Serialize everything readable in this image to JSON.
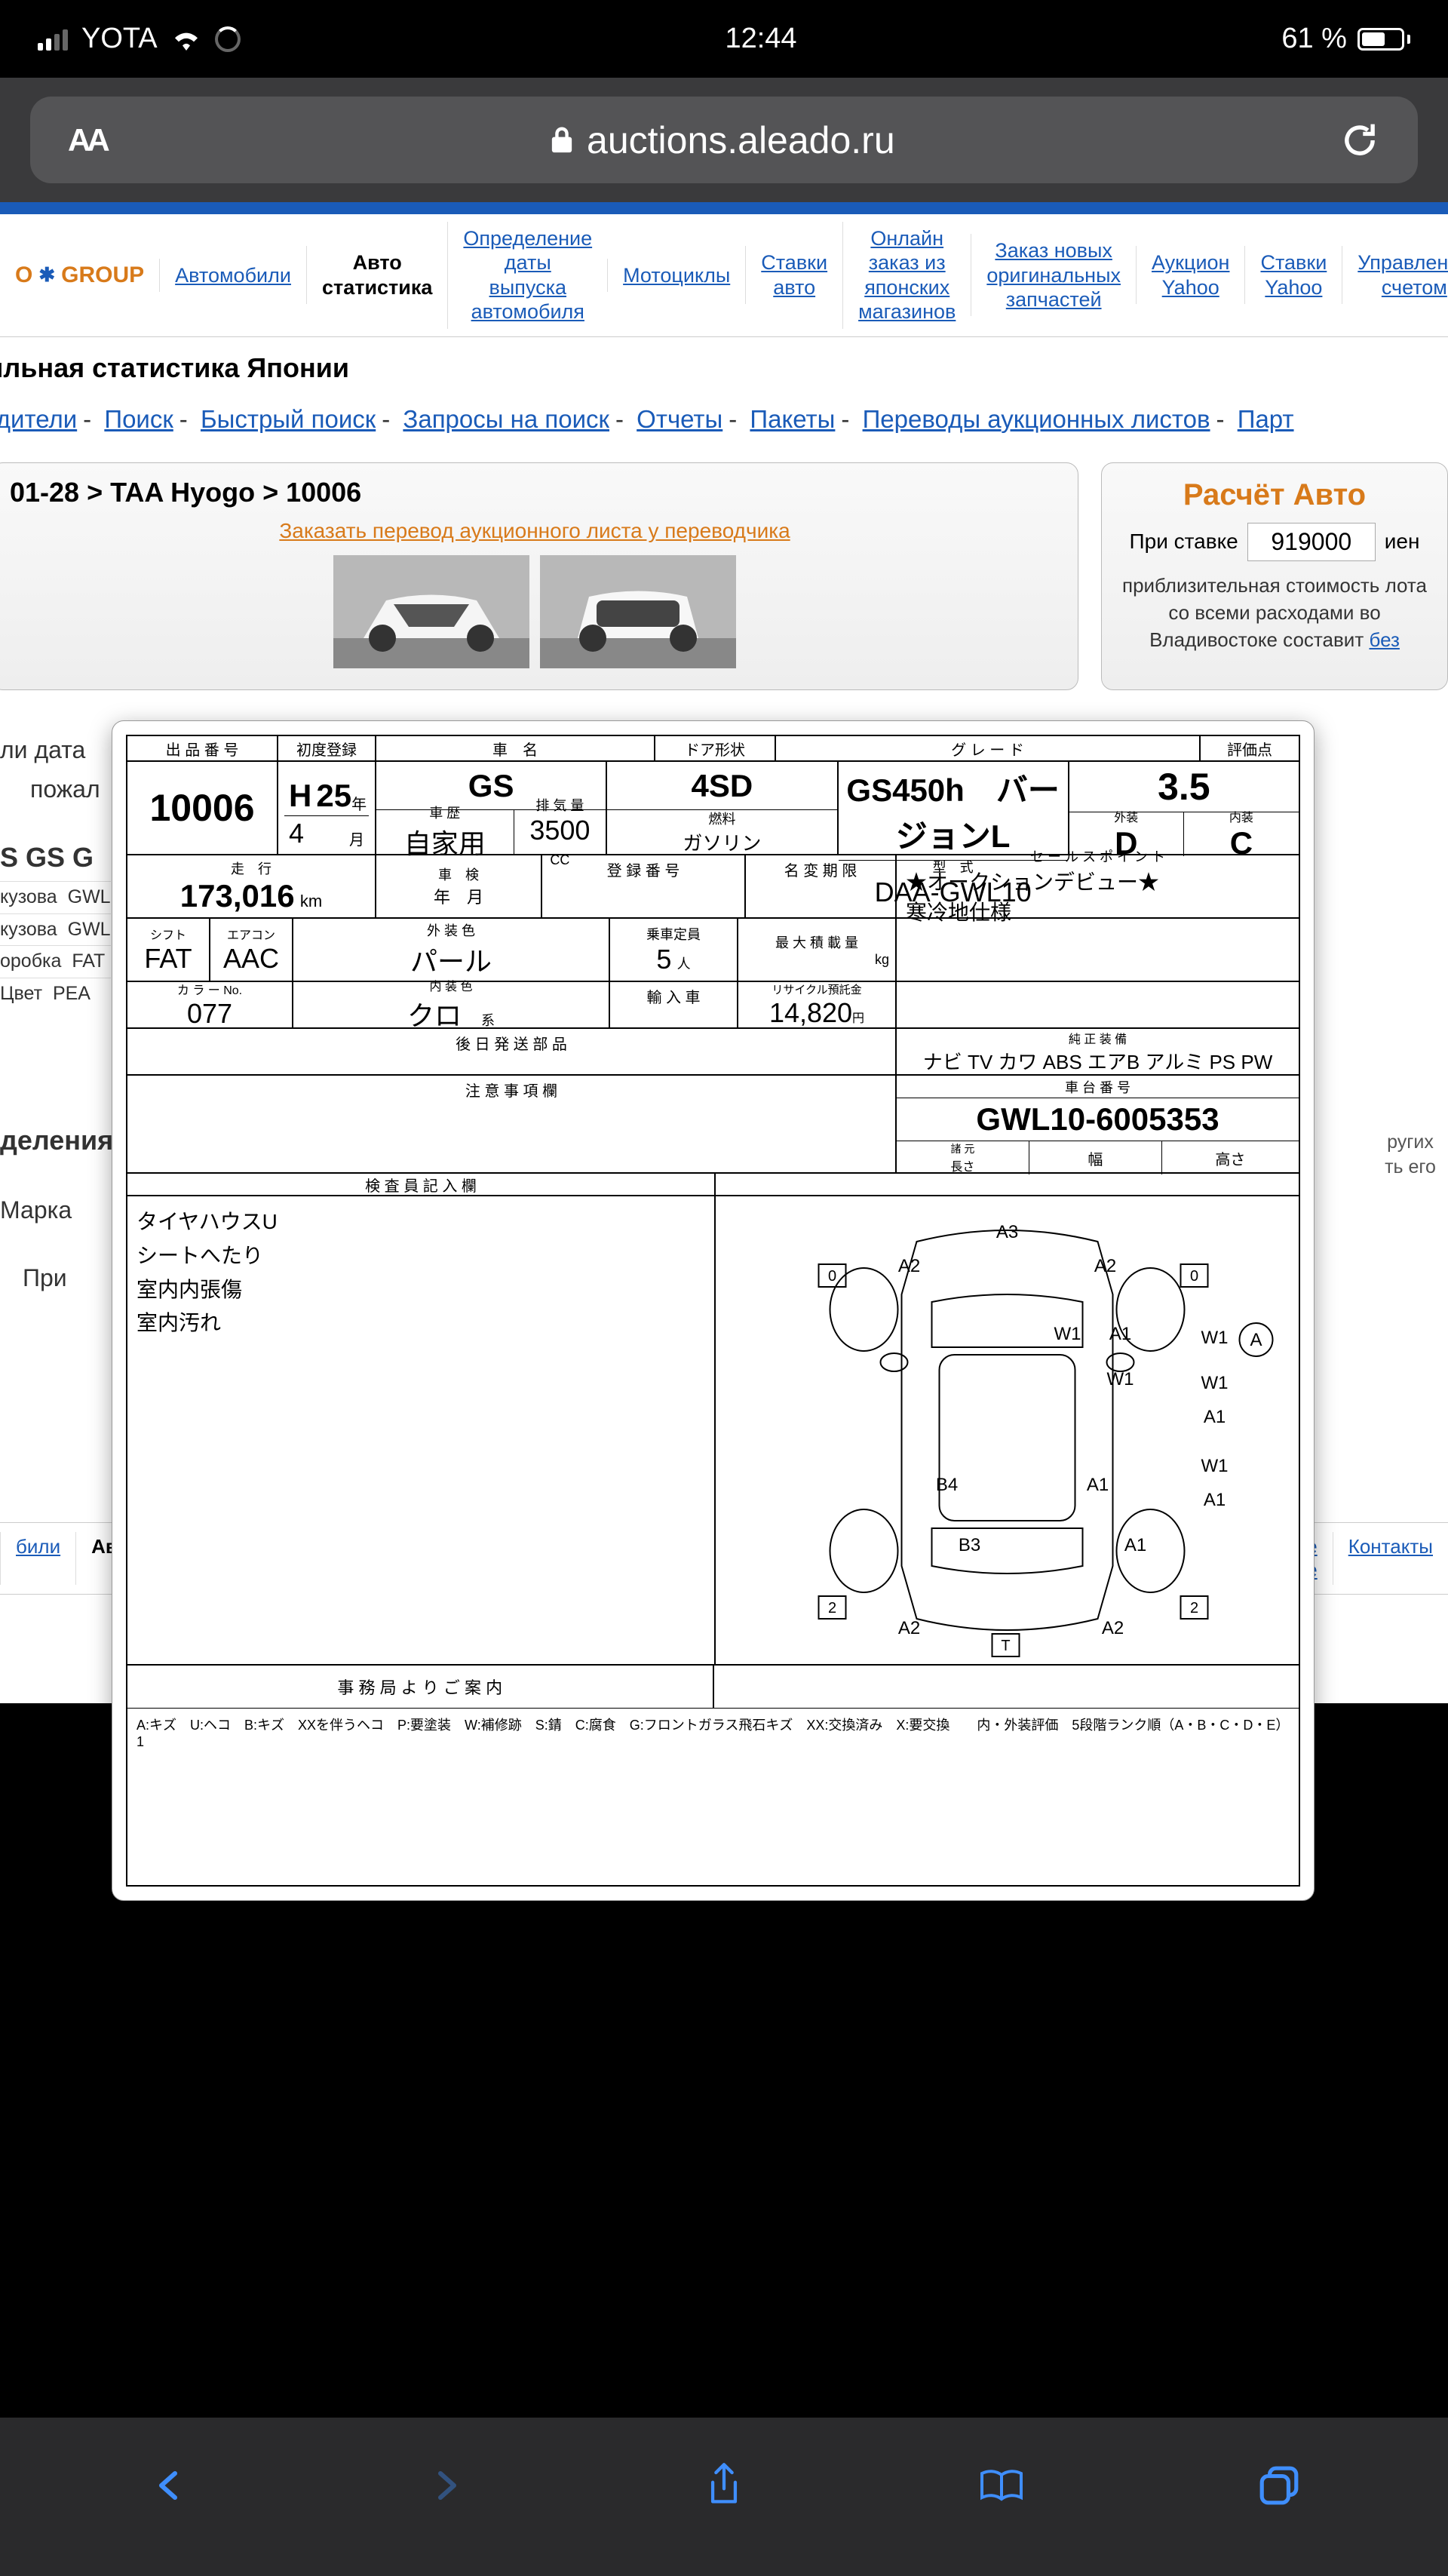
{
  "status": {
    "carrier": "YOTA",
    "time": "12:44",
    "battery_pct": "61 %"
  },
  "browser": {
    "text_size_label": "AA",
    "url": "auctions.aleado.ru"
  },
  "logo": "O ✱ GROUP",
  "top_nav": [
    "Автомобили",
    "Авто статистика",
    "Определение даты выпуска автомобиля",
    "Мотоциклы",
    "Ставки авто",
    "Онлайн заказ из японских магазинов",
    "Заказ новых оригинальных запчастей",
    "Аукцион Yahoo",
    "Ставки Yahoo",
    "Управление счетом"
  ],
  "heading": "бильная статистика Японии",
  "sub_nav": [
    "водители",
    "Поиск",
    "Быстрый поиск",
    "Запросы на поиск",
    "Отчеты",
    "Пакеты",
    "Переводы аукционных листов",
    "Парт"
  ],
  "breadcrumb": "01-28 > TAA Hyogo > 10006",
  "translate_link": "Заказать перевод аукционного листа у переводчика",
  "calc": {
    "title": "Расчёт Авто",
    "label_bid": "При ставке",
    "bid_value": "919000",
    "currency": "иен",
    "desc_1": "приблизительная стоимость лота",
    "desc_2": "со всеми расходами во",
    "desc_3": "Владивостоке составит",
    "desc_link": "без"
  },
  "edge": {
    "l1": "ли дата",
    "l2": "пожал",
    "l3": "S GS G",
    "r1": "кузова",
    "v1": "GWL",
    "r2": "кузова",
    "v2": "GWL",
    "r3": "оробка",
    "v3": "FAT",
    "r4": "Цвет",
    "v4": "PEA",
    "h1": "деления",
    "h2": "Марка",
    "h3": "При"
  },
  "right_edge": {
    "t1": "ругих",
    "t2": "ть его"
  },
  "sheet": {
    "labels": {
      "lot_no": "出 品 番 号",
      "first_reg": "初度登録",
      "car_name": "車　名",
      "door_type": "ドア形状",
      "grade": "グ レ ー ド",
      "score": "評価点",
      "history": "車 歴",
      "displacement": "排 気 量",
      "fuel": "燃料",
      "model_code": "型　式",
      "ext": "外装",
      "int": "内装",
      "mileage": "走　行",
      "inspection": "車　検",
      "reg_no": "登 録 番 号",
      "name_exp": "名 変 期 限",
      "sales_point": "セ ー ル ス ポ イ ン ト",
      "shift": "シフト",
      "aircon": "エアコン",
      "ext_color": "外 装 色",
      "capacity": "乗車定員",
      "max_load": "最 大 積 載 量",
      "color_no": "カ ラ ー No.",
      "int_color": "内 装 色",
      "import": "輸 入 車",
      "recycle": "リサイクル預託金",
      "later_parts": "後 日 発 送 部 品",
      "std_equip": "純 正 装 備",
      "notes_label": "注 意 事 項 欄",
      "chassis": "車 台 番 号",
      "dimensions": "諸 元",
      "length": "長さ",
      "width": "幅",
      "height": "高さ",
      "inspector": "検 査 員 記 入 欄",
      "office_info": "事 務 局 よ り ご 案 内"
    },
    "lot_no": "10006",
    "year_h": "H",
    "year_num": "25",
    "year_unit": "年",
    "month_num": "4",
    "month_unit": "月",
    "car_name": "GS",
    "doors": "4SD",
    "grade": "GS450h　バージョンL",
    "score": "3.5",
    "history": "自家用",
    "displacement": "3500",
    "cc": "CC",
    "fuel": "ガソリン",
    "model_code": "DAA-GWL10",
    "ext_score": "D",
    "int_score": "C",
    "mileage": "173,016",
    "mileage_unit": "km",
    "insp_ym": "年　月",
    "sp1": "★オークションデビュー★",
    "sp2": "寒冷地仕様",
    "shift": "FAT",
    "aircon": "AAC",
    "ext_color": "パール",
    "capacity": "5",
    "cap_unit": "人",
    "load_unit": "kg",
    "color_no": "077",
    "int_color": "クロ",
    "int_suffix": "系",
    "recycle": "14,820",
    "recycle_unit": "円",
    "equip": "ナビ TV カワ ABS エアB アルミ PS PW",
    "chassis": "GWL10-6005353",
    "notes": [
      "タイヤハウスU",
      "シートへたり",
      "室内内張傷",
      "室内汚れ"
    ],
    "diagram_marks": {
      "a3": "A3",
      "a2_tl": "A2",
      "a2_tr": "A2",
      "a2_bl": "A2",
      "a2_br": "A2",
      "w1_1": "W1",
      "w1_2": "W1",
      "w1_3": "W1",
      "w1_4": "W1",
      "a1_1": "A1",
      "a1_2": "A1",
      "a1_3": "A1",
      "a1_4": "A1",
      "a1_mid": "A1",
      "a": "A",
      "b4": "B4",
      "b3": "B3",
      "box_0_1": "0",
      "box_0_2": "0",
      "box_2_1": "2",
      "box_2_2": "2",
      "box_t": "T"
    },
    "legend": "A:キズ　U:ヘコ　B:キズ　XXを伴うヘコ　P:要塗装　W:補修跡　S:錆　C:腐食　G:フロントガラス飛石キズ　XX:交換済み　X:要交換　　内・外装評価　5段階ランク順（A・B・C・D・E）1"
  },
  "bottom_nav": {
    "left1": "били",
    "left2": "Авто статистика",
    "right1": "нные",
    "right2": "нные",
    "right3": "Контакты"
  }
}
